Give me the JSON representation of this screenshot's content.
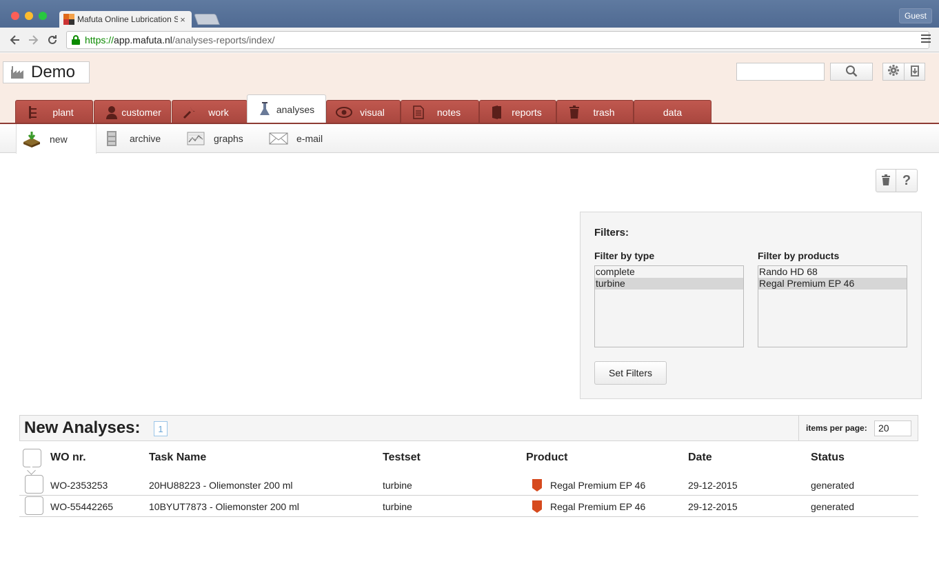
{
  "browser": {
    "tab_title": "Mafuta Online Lubrication S",
    "tab_close": "×",
    "guest_label": "Guest",
    "url_scheme": "https://",
    "url_host": "app.mafuta.nl",
    "url_path": "/analyses-reports/index/"
  },
  "header": {
    "title": "Demo",
    "search_placeholder": ""
  },
  "main_tabs": [
    {
      "label": "plant",
      "icon": "plant-icon"
    },
    {
      "label": "customer",
      "icon": "customer-icon"
    },
    {
      "label": "work",
      "icon": "wrench-icon"
    },
    {
      "label": "analyses",
      "icon": "analyses-icon",
      "active": true
    },
    {
      "label": "visual",
      "icon": "eye-icon"
    },
    {
      "label": "notes",
      "icon": "notes-icon"
    },
    {
      "label": "reports",
      "icon": "reports-icon"
    },
    {
      "label": "trash",
      "icon": "trash-icon"
    },
    {
      "label": "data",
      "icon": ""
    }
  ],
  "sub_tabs": [
    {
      "label": "new",
      "icon": "new-analysis-icon",
      "active": true
    },
    {
      "label": "archive",
      "icon": "archive-icon"
    },
    {
      "label": "graphs",
      "icon": "graphs-icon"
    },
    {
      "label": "e-mail",
      "icon": "email-icon"
    }
  ],
  "actions": {
    "help_label": "?"
  },
  "filters": {
    "title": "Filters:",
    "type_label": "Filter by type",
    "products_label": "Filter by products",
    "type_options": [
      "complete",
      "turbine"
    ],
    "type_selected": "turbine",
    "product_options": [
      "Rando HD 68",
      "Regal Premium EP 46"
    ],
    "product_selected": "Regal Premium EP 46",
    "button_label": "Set Filters"
  },
  "analyses": {
    "title": "New Analyses:",
    "page": "1",
    "items_per_page_label": "items per page:",
    "items_per_page": "20",
    "columns": [
      "WO nr.",
      "Task Name",
      "Testset",
      "Product",
      "Date",
      "Status"
    ],
    "rows": [
      {
        "wo": "WO-2353253",
        "task": "20HU88223 - Oliemonster 200 ml",
        "testset": "turbine",
        "product": "Regal Premium EP 46",
        "date": "29-12-2015",
        "status": "generated"
      },
      {
        "wo": "WO-55442265",
        "task": "10BYUT7873 - Oliemonster 200 ml",
        "testset": "turbine",
        "product": "Regal Premium EP 46",
        "date": "29-12-2015",
        "status": "generated"
      }
    ]
  },
  "colors": {
    "tab_red": "#b04e46",
    "header_bg": "#f9ece4",
    "product_icon": "#d64a1e",
    "url_green": "#0b8a00"
  }
}
